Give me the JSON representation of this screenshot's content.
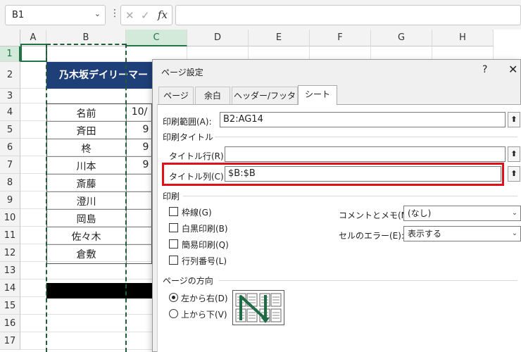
{
  "formula_bar": {
    "name_box": "B1",
    "dropdown_glyph": "⌄",
    "menu_glyph": "⋮",
    "cancel_glyph": "✕",
    "enter_glyph": "✓",
    "fx_label": "fx",
    "formula": ""
  },
  "grid": {
    "columns": [
      "A",
      "B",
      "C",
      "D",
      "E",
      "F",
      "G",
      "H"
    ],
    "selected_column": "C",
    "rows": [
      "1",
      "2",
      "3",
      "4",
      "5",
      "6",
      "7",
      "8",
      "9",
      "10",
      "11",
      "12",
      "13",
      "14",
      "15",
      "16",
      "17"
    ],
    "selected_row": "1",
    "title_text": "乃木坂デイリーマー",
    "header_name": "名前",
    "header_c": "10/",
    "names": [
      "斉田",
      "柊",
      "川本",
      "斎藤",
      "澄川",
      "岡島",
      "佐々木",
      "倉敷"
    ],
    "c_values": [
      "9",
      "9",
      "9"
    ]
  },
  "dialog": {
    "title": "ページ設定",
    "help": "?",
    "close": "✕",
    "tabs": [
      "ページ",
      "余白",
      "ヘッダー/フッター",
      "シート"
    ],
    "active_tab": "シート",
    "print_area_label": "印刷範囲(A):",
    "print_area_value": "B2:AG14",
    "collapse_glyph": "⬆",
    "print_titles_label": "印刷タイトル",
    "title_rows_label": "タイトル行(R):",
    "title_rows_value": "",
    "title_cols_label": "タイトル列(C):",
    "title_cols_value": "$B:$B",
    "print_group_label": "印刷",
    "checkboxes": [
      "枠線(G)",
      "白黒印刷(B)",
      "簡易印刷(Q)",
      "行列番号(L)"
    ],
    "comments_label": "コメントとメモ(M):",
    "comments_value": "(なし)",
    "cell_errors_label": "セルのエラー(E):",
    "cell_errors_value": "表示する",
    "page_order_label": "ページの方向",
    "radios": [
      {
        "label": "左から右(D)",
        "checked": true
      },
      {
        "label": "上から下(V)",
        "checked": false
      }
    ],
    "highlight_color": "#e0101a"
  }
}
